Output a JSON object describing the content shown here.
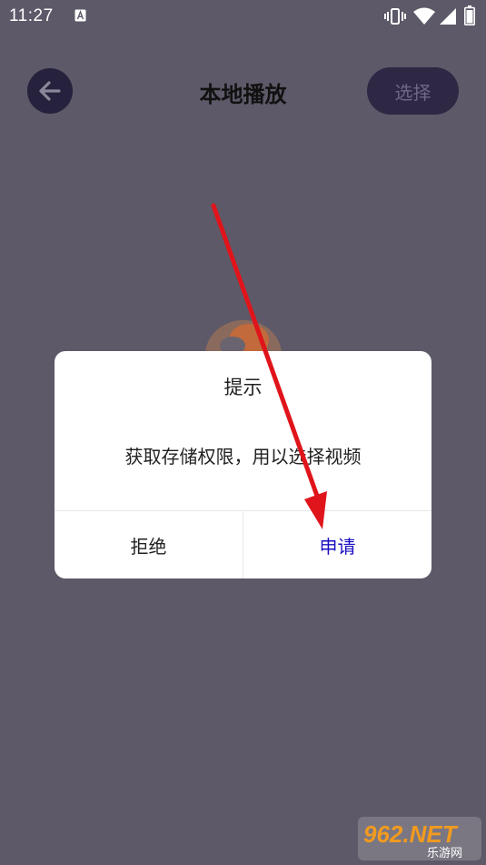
{
  "status_bar": {
    "time": "11:27",
    "icons": [
      "a-notification-icon",
      "vibrate-icon",
      "wifi-icon",
      "signal-icon",
      "battery-icon"
    ]
  },
  "header": {
    "title": "本地播放",
    "back_icon": "arrow-left-icon",
    "select_label": "选择"
  },
  "dialog": {
    "title": "提示",
    "message": "获取存储权限，用以选择视频",
    "deny_label": "拒绝",
    "request_label": "申请"
  },
  "watermark": {
    "brand": "962.NET",
    "subtitle": "乐游网"
  },
  "colors": {
    "background": "#5d5968",
    "back_button": "#26213c",
    "select_button": "#2e2845",
    "select_text": "#6e6887",
    "request_text": "#1a0ec2",
    "annotation_arrow": "#e0141b"
  }
}
